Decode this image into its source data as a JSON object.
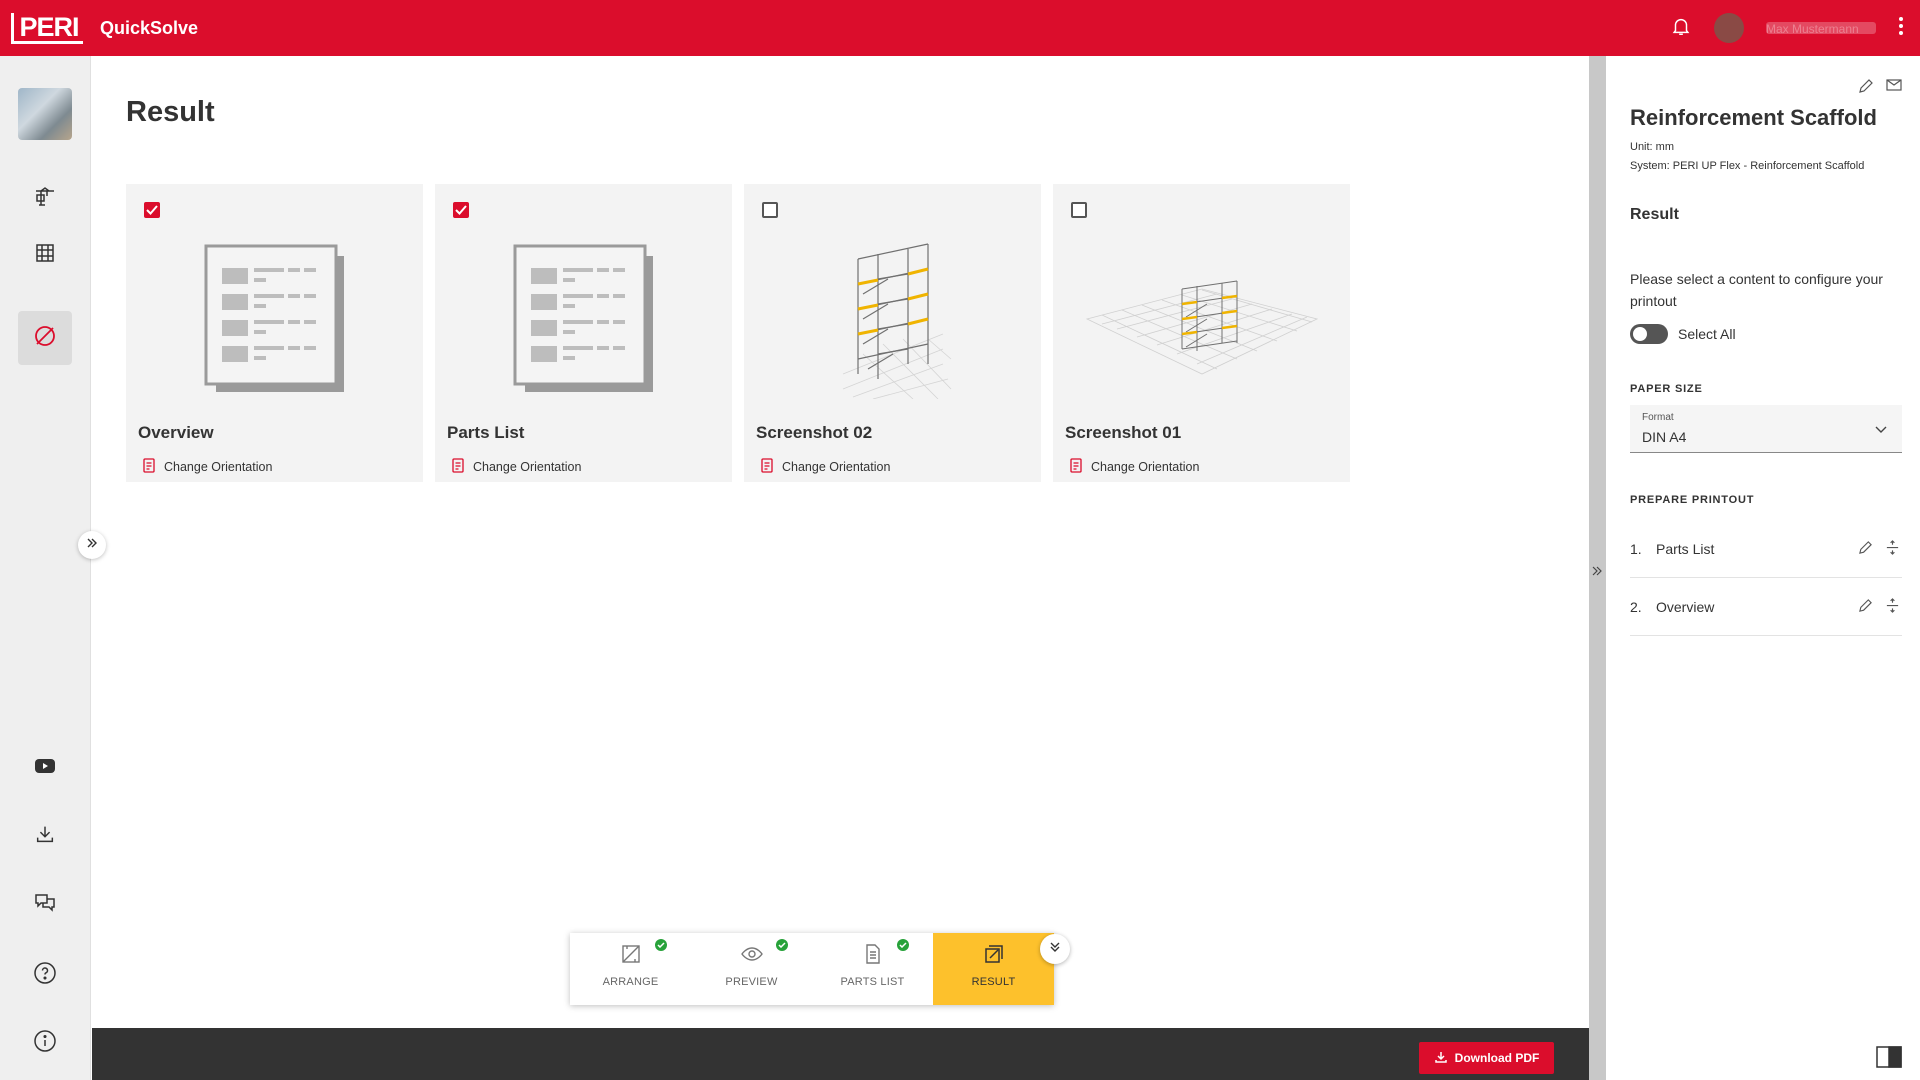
{
  "app": {
    "brand": "PERI",
    "title": "QuickSolve",
    "user_name": "Max Mustermann"
  },
  "page": {
    "title": "Result"
  },
  "cards": [
    {
      "title": "Overview",
      "checked": true,
      "thumbnail": "document-icon",
      "action": "Change Orientation"
    },
    {
      "title": "Parts List",
      "checked": true,
      "thumbnail": "document-icon",
      "action": "Change Orientation"
    },
    {
      "title": "Screenshot 02",
      "checked": false,
      "thumbnail": "scaffold-closeup",
      "action": "Change Orientation"
    },
    {
      "title": "Screenshot 01",
      "checked": false,
      "thumbnail": "scaffold-wide",
      "action": "Change Orientation"
    }
  ],
  "stepper": {
    "steps": [
      {
        "label": "ARRANGE",
        "done": true,
        "icon": "arrange-icon"
      },
      {
        "label": "PREVIEW",
        "done": true,
        "icon": "eye-icon"
      },
      {
        "label": "PARTS LIST",
        "done": true,
        "icon": "document-icon"
      },
      {
        "label": "RESULT",
        "done": false,
        "active": true,
        "icon": "result-icon"
      }
    ]
  },
  "bottom": {
    "download_label": "Download PDF"
  },
  "panel": {
    "title": "Reinforcement Scaffold",
    "unit": "Unit: mm",
    "system": "System: PERI UP Flex - Reinforcement Scaffold",
    "section_title": "Result",
    "description": "Please select a content to configure your printout",
    "select_all_label": "Select All",
    "select_all_on": false,
    "paper_size_label": "PAPER SIZE",
    "format_label": "Format",
    "format_value": "DIN A4",
    "prepare_label": "PREPARE PRINTOUT",
    "printout": [
      {
        "num": "1.",
        "name": "Parts List"
      },
      {
        "num": "2.",
        "name": "Overview"
      }
    ]
  },
  "colors": {
    "brand_red": "#db0d2c",
    "accent_yellow": "#fdc12c",
    "success_green": "#27a23a",
    "dark_bar": "#333333"
  }
}
